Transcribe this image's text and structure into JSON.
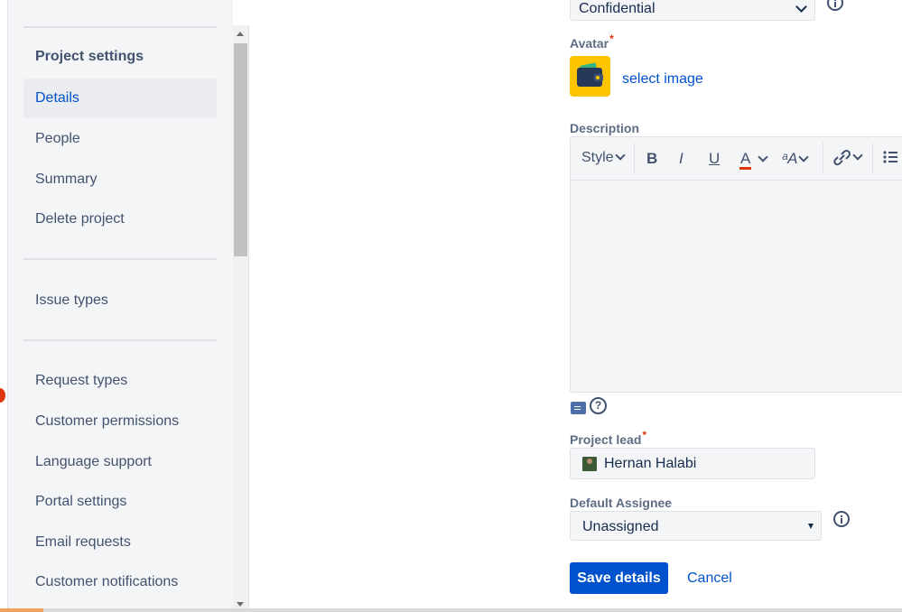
{
  "sidebar": {
    "heading": "Project settings",
    "group1": [
      {
        "label": "Details",
        "active": true
      },
      {
        "label": "People"
      },
      {
        "label": "Summary"
      },
      {
        "label": "Delete project"
      }
    ],
    "group2": [
      {
        "label": "Issue types"
      }
    ],
    "group3": [
      {
        "label": "Request types"
      },
      {
        "label": "Customer permissions"
      },
      {
        "label": "Language support"
      },
      {
        "label": "Portal settings"
      },
      {
        "label": "Email requests"
      },
      {
        "label": "Customer notifications"
      }
    ]
  },
  "form": {
    "category_value": "Confidential",
    "avatar_label": "Avatar",
    "select_image_label": "select image",
    "description_label": "Description",
    "toolbar": {
      "style": "Style",
      "bold": "B",
      "italic": "I",
      "underline": "U",
      "text_color": "A",
      "more_formatting": "ᵃA"
    },
    "project_lead_label": "Project lead",
    "project_lead_value": "Hernan Halabi",
    "default_assignee_label": "Default Assignee",
    "default_assignee_value": "Unassigned",
    "save_label": "Save details",
    "cancel_label": "Cancel",
    "required_mark": "*",
    "help_glyph": "?"
  },
  "colors": {
    "primary": "#0052cc",
    "required": "#de350b",
    "avatar_bg": "#ffc400",
    "sidebar_bg": "#f4f5f7",
    "text_color_underline": "#de350b"
  }
}
